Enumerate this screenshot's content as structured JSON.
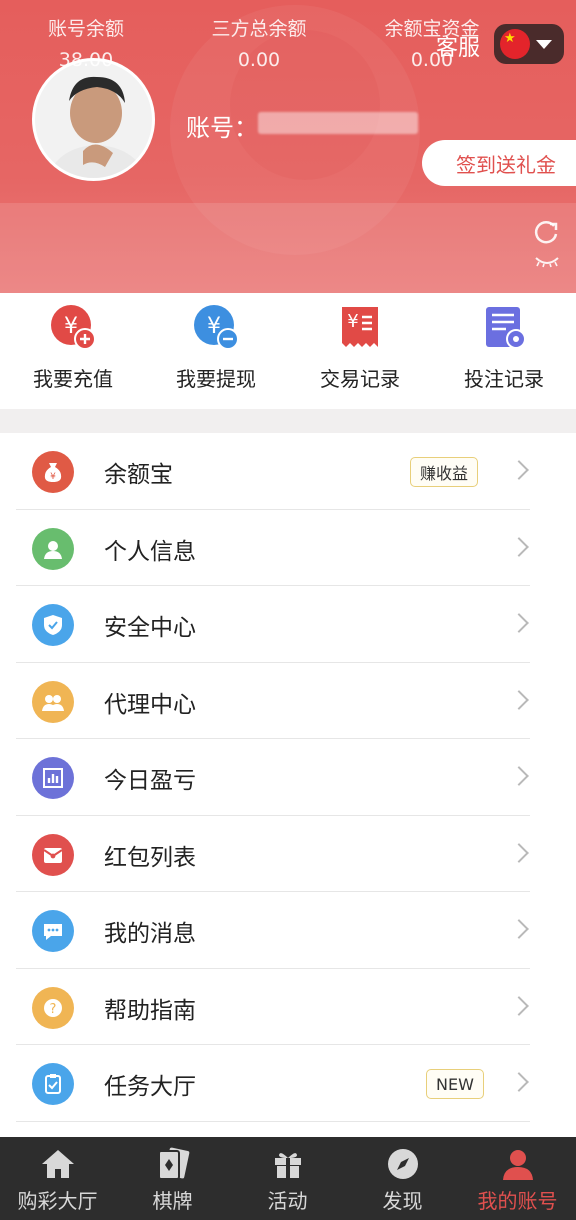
{
  "header": {
    "service_label": "客服",
    "language_flag_icon": "china-flag-icon",
    "account_label": "账号：",
    "signin_button": "签到送礼金"
  },
  "balances": [
    {
      "label": "账号余额",
      "value": "38.00"
    },
    {
      "label": "三方总余额",
      "value": "0.00"
    },
    {
      "label": "余额宝资金",
      "value": "0.00"
    }
  ],
  "quick_actions": [
    {
      "label": "我要充值",
      "icon": "recharge-icon",
      "color": "#e14a46"
    },
    {
      "label": "我要提现",
      "icon": "withdraw-icon",
      "color": "#3d8fe0"
    },
    {
      "label": "交易记录",
      "icon": "transaction-record-icon",
      "color": "#e14a46"
    },
    {
      "label": "投注记录",
      "icon": "bet-record-icon",
      "color": "#6b6fe0"
    }
  ],
  "menu": [
    {
      "label": "余额宝",
      "icon": "money-bag-icon",
      "color": "#e05a45",
      "tag": "赚收益"
    },
    {
      "label": "个人信息",
      "icon": "user-icon",
      "color": "#68bd6e",
      "tag": ""
    },
    {
      "label": "安全中心",
      "icon": "shield-icon",
      "color": "#4aa5ea",
      "tag": ""
    },
    {
      "label": "代理中心",
      "icon": "agents-icon",
      "color": "#f0b554",
      "tag": ""
    },
    {
      "label": "今日盈亏",
      "icon": "bar-chart-icon",
      "color": "#6d72d8",
      "tag": ""
    },
    {
      "label": "红包列表",
      "icon": "red-envelope-icon",
      "color": "#e0504e",
      "tag": ""
    },
    {
      "label": "我的消息",
      "icon": "message-icon",
      "color": "#4aa5ea",
      "tag": ""
    },
    {
      "label": "帮助指南",
      "icon": "help-icon",
      "color": "#f0b554",
      "tag": ""
    },
    {
      "label": "任务大厅",
      "icon": "task-clipboard-icon",
      "color": "#4aa5ea",
      "tag": "NEW"
    }
  ],
  "tabs": [
    {
      "label": "购彩大厅",
      "icon": "home-icon",
      "active": false
    },
    {
      "label": "棋牌",
      "icon": "cards-icon",
      "active": false
    },
    {
      "label": "活动",
      "icon": "gift-icon",
      "active": false
    },
    {
      "label": "发现",
      "icon": "compass-icon",
      "active": false
    },
    {
      "label": "我的账号",
      "icon": "account-icon",
      "active": true
    }
  ],
  "colors": {
    "brand_red": "#e55e5c",
    "tabbar_bg": "#2d2d2d",
    "active_tab": "#e0504e"
  }
}
